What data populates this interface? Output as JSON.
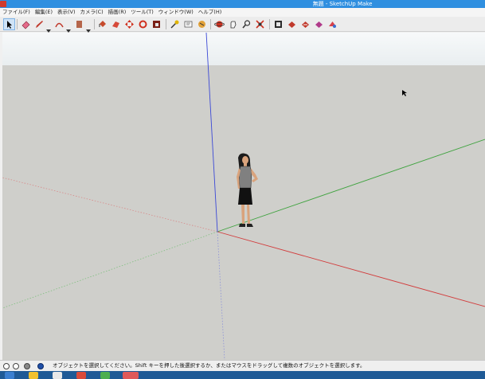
{
  "window": {
    "title": "無題 - SketchUp Make"
  },
  "menu": {
    "items": [
      "ファイル(F)",
      "編集(E)",
      "表示(V)",
      "カメラ(C)",
      "描画(R)",
      "ツール(T)",
      "ウィンドウ(W)",
      "ヘルプ(H)"
    ]
  },
  "toolbar": {
    "tools": [
      "select-icon",
      "eraser-icon",
      "pencil-icon",
      "arc-icon",
      "shape-icon",
      "paint-bucket-icon",
      "push-pull-icon",
      "follow-me-icon",
      "move-icon",
      "rotate-icon",
      "scale-icon",
      "tape-measure-icon",
      "text-icon",
      "dimension-icon",
      "orbit-icon",
      "pan-icon",
      "zoom-icon",
      "zoom-extents-icon",
      "warehouse-icon",
      "extension-icon",
      "ruby-icon",
      "layout-icon"
    ]
  },
  "statusbar": {
    "icons": [
      "geo-location-icon",
      "info-icon",
      "user-icon",
      "help-icon"
    ],
    "text": "オブジェクトを選択してください。Shift キーを押した後選択するか、またはマウスをドラッグして複数のオブジェクトを選択します。"
  },
  "colors": {
    "x_axis": "#d23b3b",
    "y_axis": "#3fa33f",
    "z_axis": "#3b48d6",
    "ground": "#cfcfcb",
    "sky": "#f4f7f8",
    "titlebar": "#2f8fe0"
  }
}
